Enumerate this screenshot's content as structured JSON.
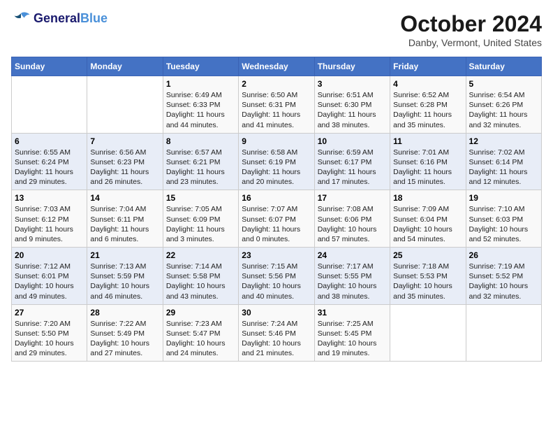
{
  "header": {
    "logo_line1": "General",
    "logo_line2": "Blue",
    "month": "October 2024",
    "location": "Danby, Vermont, United States"
  },
  "days_of_week": [
    "Sunday",
    "Monday",
    "Tuesday",
    "Wednesday",
    "Thursday",
    "Friday",
    "Saturday"
  ],
  "weeks": [
    [
      {
        "day": "",
        "content": ""
      },
      {
        "day": "",
        "content": ""
      },
      {
        "day": "1",
        "content": "Sunrise: 6:49 AM\nSunset: 6:33 PM\nDaylight: 11 hours and 44 minutes."
      },
      {
        "day": "2",
        "content": "Sunrise: 6:50 AM\nSunset: 6:31 PM\nDaylight: 11 hours and 41 minutes."
      },
      {
        "day": "3",
        "content": "Sunrise: 6:51 AM\nSunset: 6:30 PM\nDaylight: 11 hours and 38 minutes."
      },
      {
        "day": "4",
        "content": "Sunrise: 6:52 AM\nSunset: 6:28 PM\nDaylight: 11 hours and 35 minutes."
      },
      {
        "day": "5",
        "content": "Sunrise: 6:54 AM\nSunset: 6:26 PM\nDaylight: 11 hours and 32 minutes."
      }
    ],
    [
      {
        "day": "6",
        "content": "Sunrise: 6:55 AM\nSunset: 6:24 PM\nDaylight: 11 hours and 29 minutes."
      },
      {
        "day": "7",
        "content": "Sunrise: 6:56 AM\nSunset: 6:23 PM\nDaylight: 11 hours and 26 minutes."
      },
      {
        "day": "8",
        "content": "Sunrise: 6:57 AM\nSunset: 6:21 PM\nDaylight: 11 hours and 23 minutes."
      },
      {
        "day": "9",
        "content": "Sunrise: 6:58 AM\nSunset: 6:19 PM\nDaylight: 11 hours and 20 minutes."
      },
      {
        "day": "10",
        "content": "Sunrise: 6:59 AM\nSunset: 6:17 PM\nDaylight: 11 hours and 17 minutes."
      },
      {
        "day": "11",
        "content": "Sunrise: 7:01 AM\nSunset: 6:16 PM\nDaylight: 11 hours and 15 minutes."
      },
      {
        "day": "12",
        "content": "Sunrise: 7:02 AM\nSunset: 6:14 PM\nDaylight: 11 hours and 12 minutes."
      }
    ],
    [
      {
        "day": "13",
        "content": "Sunrise: 7:03 AM\nSunset: 6:12 PM\nDaylight: 11 hours and 9 minutes."
      },
      {
        "day": "14",
        "content": "Sunrise: 7:04 AM\nSunset: 6:11 PM\nDaylight: 11 hours and 6 minutes."
      },
      {
        "day": "15",
        "content": "Sunrise: 7:05 AM\nSunset: 6:09 PM\nDaylight: 11 hours and 3 minutes."
      },
      {
        "day": "16",
        "content": "Sunrise: 7:07 AM\nSunset: 6:07 PM\nDaylight: 11 hours and 0 minutes."
      },
      {
        "day": "17",
        "content": "Sunrise: 7:08 AM\nSunset: 6:06 PM\nDaylight: 10 hours and 57 minutes."
      },
      {
        "day": "18",
        "content": "Sunrise: 7:09 AM\nSunset: 6:04 PM\nDaylight: 10 hours and 54 minutes."
      },
      {
        "day": "19",
        "content": "Sunrise: 7:10 AM\nSunset: 6:03 PM\nDaylight: 10 hours and 52 minutes."
      }
    ],
    [
      {
        "day": "20",
        "content": "Sunrise: 7:12 AM\nSunset: 6:01 PM\nDaylight: 10 hours and 49 minutes."
      },
      {
        "day": "21",
        "content": "Sunrise: 7:13 AM\nSunset: 5:59 PM\nDaylight: 10 hours and 46 minutes."
      },
      {
        "day": "22",
        "content": "Sunrise: 7:14 AM\nSunset: 5:58 PM\nDaylight: 10 hours and 43 minutes."
      },
      {
        "day": "23",
        "content": "Sunrise: 7:15 AM\nSunset: 5:56 PM\nDaylight: 10 hours and 40 minutes."
      },
      {
        "day": "24",
        "content": "Sunrise: 7:17 AM\nSunset: 5:55 PM\nDaylight: 10 hours and 38 minutes."
      },
      {
        "day": "25",
        "content": "Sunrise: 7:18 AM\nSunset: 5:53 PM\nDaylight: 10 hours and 35 minutes."
      },
      {
        "day": "26",
        "content": "Sunrise: 7:19 AM\nSunset: 5:52 PM\nDaylight: 10 hours and 32 minutes."
      }
    ],
    [
      {
        "day": "27",
        "content": "Sunrise: 7:20 AM\nSunset: 5:50 PM\nDaylight: 10 hours and 29 minutes."
      },
      {
        "day": "28",
        "content": "Sunrise: 7:22 AM\nSunset: 5:49 PM\nDaylight: 10 hours and 27 minutes."
      },
      {
        "day": "29",
        "content": "Sunrise: 7:23 AM\nSunset: 5:47 PM\nDaylight: 10 hours and 24 minutes."
      },
      {
        "day": "30",
        "content": "Sunrise: 7:24 AM\nSunset: 5:46 PM\nDaylight: 10 hours and 21 minutes."
      },
      {
        "day": "31",
        "content": "Sunrise: 7:25 AM\nSunset: 5:45 PM\nDaylight: 10 hours and 19 minutes."
      },
      {
        "day": "",
        "content": ""
      },
      {
        "day": "",
        "content": ""
      }
    ]
  ]
}
